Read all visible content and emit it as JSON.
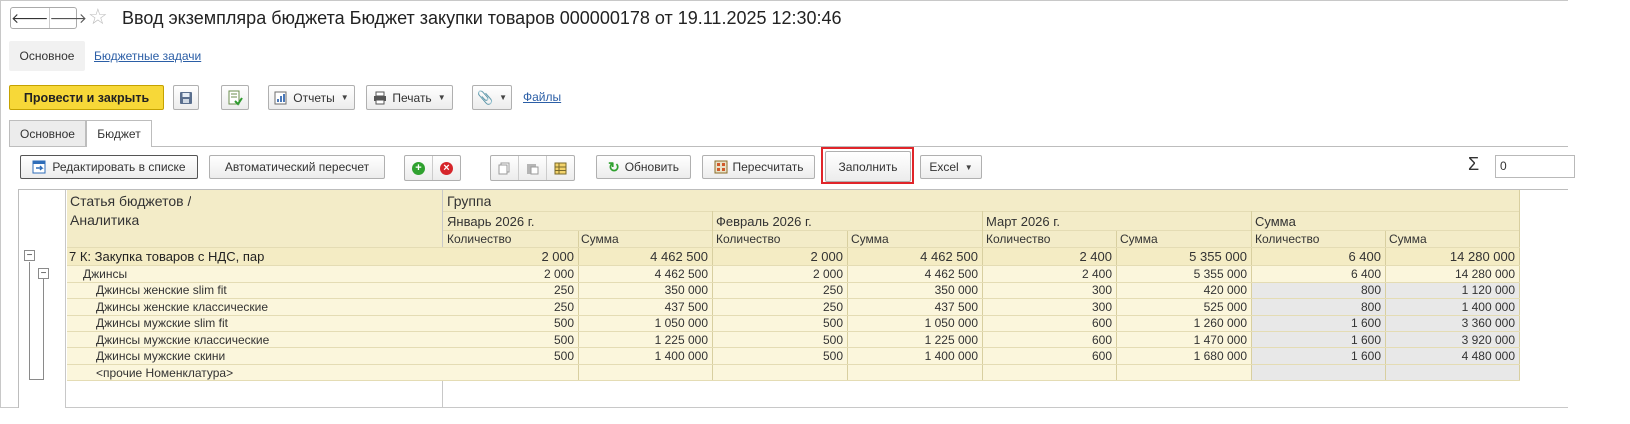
{
  "window": {
    "title": "Ввод экземпляра бюджета Бюджет закупки товаров 000000178 от 19.11.2025 12:30:46",
    "nav_back": "🡐",
    "nav_forward": "🡒",
    "star_icon": "☆"
  },
  "section_tabs": [
    {
      "label": "Основное"
    },
    {
      "label": "Бюджетные задачи"
    }
  ],
  "toolbar": {
    "post_close": "Провести и закрыть",
    "reports": "Отчеты",
    "print": "Печать",
    "files": "Файлы"
  },
  "form_tabs": [
    {
      "label": "Основное"
    },
    {
      "label": "Бюджет"
    }
  ],
  "table_toolbar": {
    "edit_in_list": "Редактировать в списке",
    "auto_recalc": "Автоматический пересчет",
    "refresh": "Обновить",
    "recalc": "Пересчитать",
    "fill": "Заполнить",
    "excel": "Excel",
    "sigma": "Σ",
    "sum_value": "0"
  },
  "grid": {
    "header_row_label": "Статья бюджетов /",
    "header_row_sublabel": "Аналитика",
    "group_label": "Группа",
    "periods": [
      "Январь 2026 г.",
      "Февраль 2026 г.",
      "Март 2026 г.",
      "Сумма"
    ],
    "col_qty": "Количество",
    "col_sum": "Сумма",
    "rows": [
      {
        "label": "7 К: Закупка товаров с НДС, пар",
        "level": 0,
        "toggle": "−",
        "values": [
          "2 000",
          "4 462 500",
          "2 000",
          "4 462 500",
          "2 400",
          "5 355 000",
          "6 400",
          "14 280 000"
        ]
      },
      {
        "label": "Джинсы",
        "level": 1,
        "toggle": "−",
        "values": [
          "2 000",
          "4 462 500",
          "2 000",
          "4 462 500",
          "2 400",
          "5 355 000",
          "6 400",
          "14 280 000"
        ]
      },
      {
        "label": "Джинсы женские slim fit",
        "level": 2,
        "values": [
          "250",
          "350 000",
          "250",
          "350 000",
          "300",
          "420 000",
          "800",
          "1 120 000"
        ]
      },
      {
        "label": "Джинсы женские классические",
        "level": 2,
        "values": [
          "250",
          "437 500",
          "250",
          "437 500",
          "300",
          "525 000",
          "800",
          "1 400 000"
        ]
      },
      {
        "label": "Джинсы мужские slim fit",
        "level": 2,
        "values": [
          "500",
          "1 050 000",
          "500",
          "1 050 000",
          "600",
          "1 260 000",
          "1 600",
          "3 360 000"
        ]
      },
      {
        "label": "Джинсы мужские классические",
        "level": 2,
        "values": [
          "500",
          "1 225 000",
          "500",
          "1 225 000",
          "600",
          "1 470 000",
          "1 600",
          "3 920 000"
        ]
      },
      {
        "label": "Джинсы мужские скини",
        "level": 2,
        "values": [
          "500",
          "1 400 000",
          "500",
          "1 400 000",
          "600",
          "1 680 000",
          "1 600",
          "4 480 000"
        ]
      },
      {
        "label": "<прочие Номенклатура>",
        "level": 2,
        "values": [
          "",
          "",
          "",
          "",
          "",
          "",
          "",
          ""
        ]
      }
    ]
  }
}
